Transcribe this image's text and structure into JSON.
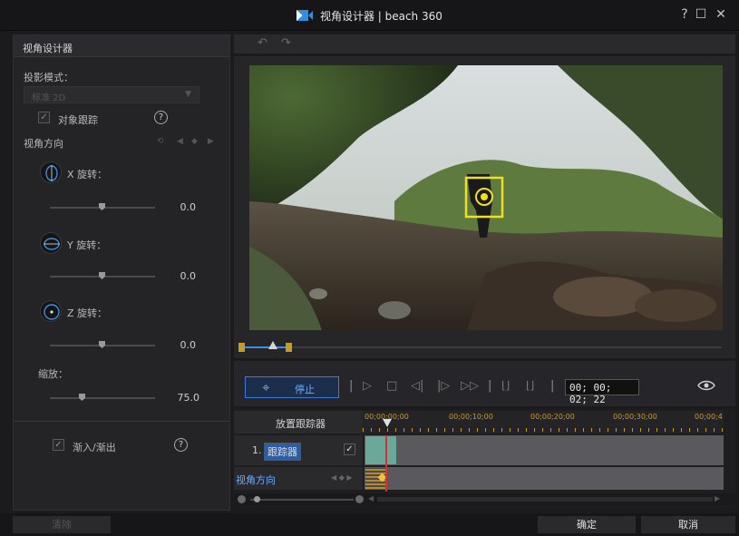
{
  "window": {
    "title": "视角设计器 | beach 360",
    "help": "?",
    "maximize": "☐",
    "close": "✕"
  },
  "left_panel": {
    "header": "视角设计器",
    "projection_label": "投影模式：",
    "projection_value": "标准 2D",
    "object_tracking_label": "对象跟踪",
    "view_direction_label": "视角方向",
    "x_rotation": {
      "label": "X 旋转：",
      "value": "0.0"
    },
    "y_rotation": {
      "label": "Y 旋转：",
      "value": "0.0"
    },
    "z_rotation": {
      "label": "Z 旋转：",
      "value": "0.0"
    },
    "zoom": {
      "label": "缩放：",
      "value": "75.0"
    },
    "fade_label": "渐入/渐出"
  },
  "controls": {
    "stop_label": "停止",
    "timecode": "00; 00; 02; 22"
  },
  "timeline": {
    "place_tracker": "放置跟踪器",
    "ticks": [
      "00;00;00;00",
      "00;00;10;00",
      "00;00;20;00",
      "00;00;30;00",
      "00;00;4"
    ],
    "track_number": "1.",
    "track_name": "跟踪器",
    "view_direction": "视角方向"
  },
  "footer": {
    "clear": "清除",
    "ok": "确定",
    "cancel": "取消"
  },
  "colors": {
    "accent": "#3d7ad6",
    "tracker": "#f0e020",
    "timeline_gold": "#c79b28",
    "clip": "#6aa89a",
    "playhead": "#d83030"
  }
}
